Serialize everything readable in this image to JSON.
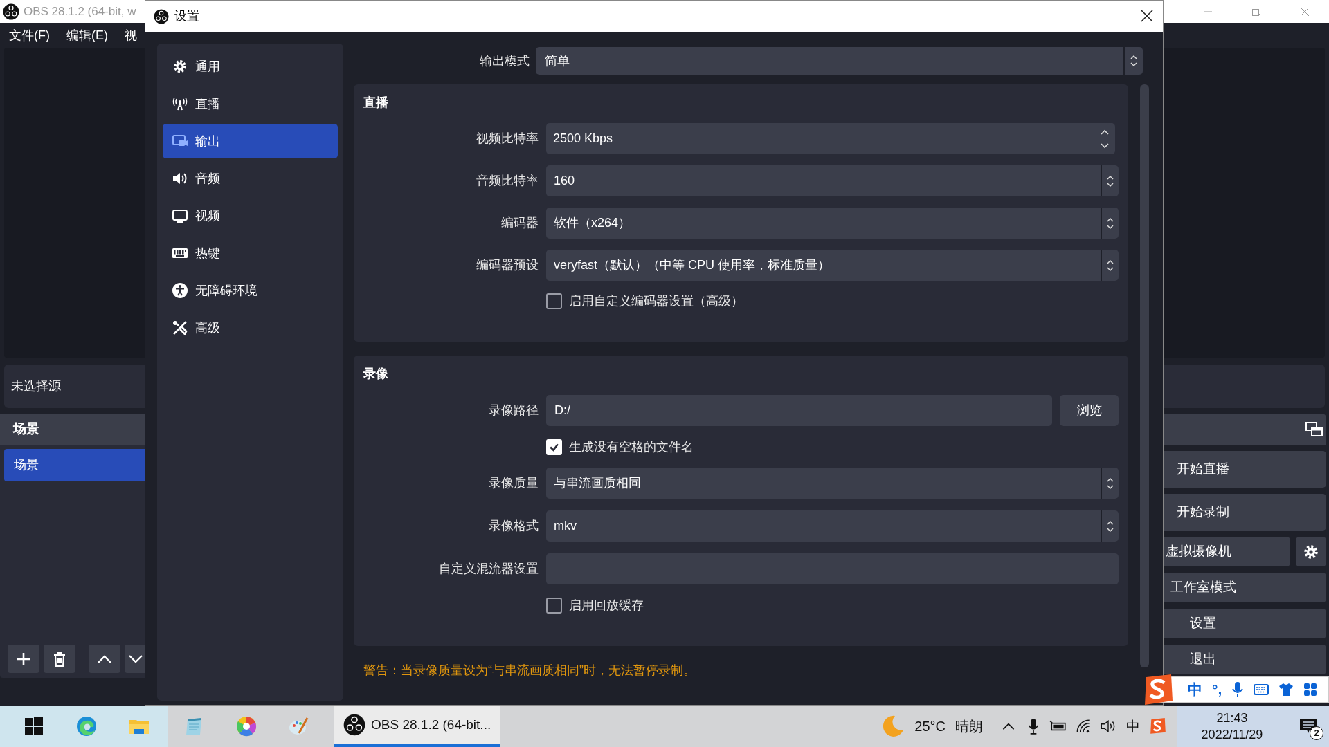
{
  "main_window": {
    "title": "OBS 28.1.2 (64-bit, w",
    "menu": [
      "文件(F)",
      "编辑(E)",
      "视"
    ],
    "context_bar": {
      "text": "未选择源"
    },
    "scenes_dock": {
      "title": "场景",
      "scenes": [
        {
          "label": "场景",
          "selected": true
        }
      ]
    },
    "controls": [
      {
        "kind": "plain",
        "label": "开始直播"
      },
      {
        "kind": "plain",
        "label": "开始录制"
      },
      {
        "kind": "camera",
        "label": "虚拟摄像机"
      },
      {
        "kind": "plain",
        "label": "工作室模式"
      },
      {
        "kind": "plain",
        "label": "设置"
      },
      {
        "kind": "plain",
        "label": "退出"
      }
    ]
  },
  "settings_dialog": {
    "title": "设置",
    "sidebar": [
      {
        "kind": "general",
        "label": "通用",
        "selected": false
      },
      {
        "kind": "stream",
        "label": "直播",
        "selected": false
      },
      {
        "kind": "output",
        "label": "输出",
        "selected": true
      },
      {
        "kind": "audio",
        "label": "音频",
        "selected": false
      },
      {
        "kind": "video",
        "label": "视频",
        "selected": false
      },
      {
        "kind": "hotkeys",
        "label": "热键",
        "selected": false
      },
      {
        "kind": "accessibility",
        "label": "无障碍环境",
        "selected": false
      },
      {
        "kind": "advanced",
        "label": "高级",
        "selected": false
      }
    ],
    "output_mode": {
      "label": "输出模式",
      "value": "简单"
    },
    "groups": [
      {
        "title": "直播",
        "rows": [
          {
            "kind": "spin",
            "label": "视频比特率",
            "value": "2500 Kbps"
          },
          {
            "kind": "combo",
            "label": "音频比特率",
            "value": "160"
          },
          {
            "kind": "combo",
            "label": "编码器",
            "value": "软件（x264）"
          },
          {
            "kind": "combo",
            "label": "编码器预设",
            "value": "veryfast（默认）（中等 CPU 使用率，标准质量）"
          },
          {
            "kind": "checkbox",
            "label": "启用自定义编码器设置（高级）",
            "checked": false
          }
        ]
      },
      {
        "title": "录像",
        "rows": [
          {
            "kind": "path",
            "label": "录像路径",
            "value": "D:/",
            "button": "浏览"
          },
          {
            "kind": "checkbox",
            "label": "生成没有空格的文件名",
            "checked": true
          },
          {
            "kind": "combo",
            "label": "录像质量",
            "value": "与串流画质相同"
          },
          {
            "kind": "combo",
            "label": "录像格式",
            "value": "mkv"
          },
          {
            "kind": "text",
            "label": "自定义混流器设置"
          },
          {
            "kind": "checkbox",
            "label": "启用回放缓存",
            "checked": false
          }
        ]
      }
    ],
    "warning": "警告：当录像质量设为“与串流画质相同”时，无法暂停录制。"
  },
  "ime_toolbar": {
    "mode": "中",
    "punctuation": "°,"
  },
  "taskbar": {
    "apps": [
      {
        "kind": "start",
        "selected": false
      },
      {
        "kind": "browser",
        "selected": false
      },
      {
        "kind": "folder",
        "selected": false
      },
      {
        "kind": "notepad",
        "selected": false
      },
      {
        "kind": "colorwheel",
        "selected": false
      },
      {
        "kind": "paint",
        "selected": false
      },
      {
        "kind": "obs",
        "label": "OBS 28.1.2 (64-bit...",
        "selected": true
      }
    ],
    "weather": {
      "temperature": "25°C",
      "condition": "晴朗"
    },
    "tray": [
      {
        "kind": "chevron"
      },
      {
        "kind": "mic"
      },
      {
        "kind": "battery"
      },
      {
        "kind": "wifi"
      },
      {
        "kind": "volume"
      },
      {
        "kind": "ime",
        "label": "中"
      },
      {
        "kind": "sogou"
      }
    ],
    "clock": {
      "time": "21:43",
      "date": "2022/11/29"
    },
    "notifications": {
      "count": "2"
    }
  }
}
